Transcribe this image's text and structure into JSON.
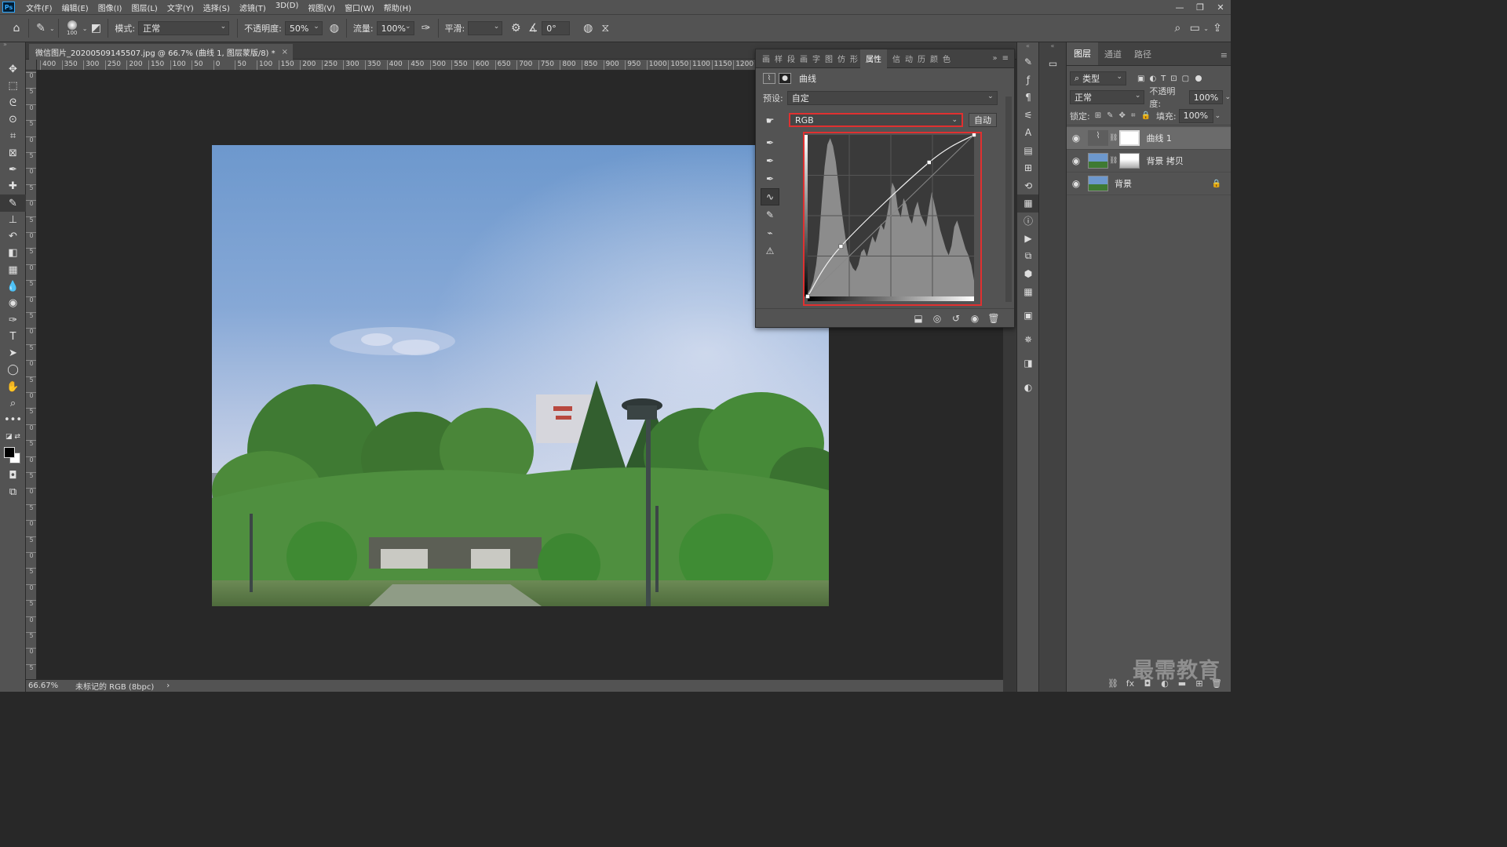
{
  "menubar": {
    "logo": "Ps",
    "items": [
      "文件(F)",
      "编辑(E)",
      "图像(I)",
      "图层(L)",
      "文字(Y)",
      "选择(S)",
      "滤镜(T)",
      "3D(D)",
      "视图(V)",
      "窗口(W)",
      "帮助(H)"
    ],
    "window_controls": [
      "—",
      "❐",
      "✕"
    ]
  },
  "options": {
    "brush_size": "100",
    "mode_label": "模式:",
    "mode_value": "正常",
    "opacity_label": "不透明度:",
    "opacity_value": "50%",
    "flow_label": "流量:",
    "flow_value": "100%",
    "smooth_label": "平滑:",
    "smooth_value": "",
    "angle_value": "0°"
  },
  "document": {
    "tab_title": "微信图片_20200509145507.jpg @ 66.7% (曲线 1, 图层蒙版/8) *",
    "close": "×"
  },
  "ruler": {
    "h_ticks": [
      "400",
      "350",
      "300",
      "250",
      "200",
      "150",
      "100",
      "50",
      "0",
      "50",
      "100",
      "150",
      "200",
      "250",
      "300",
      "350",
      "400",
      "450",
      "500",
      "550",
      "600",
      "650",
      "700",
      "750",
      "800",
      "850",
      "900",
      "950",
      "1000",
      "1050",
      "1100",
      "1150",
      "1200",
      "12"
    ],
    "v_ticks": [
      "0",
      "5",
      "0",
      "5",
      "0",
      "5",
      "0",
      "5",
      "0",
      "5",
      "0",
      "5",
      "0",
      "5",
      "0",
      "5",
      "0",
      "5",
      "0",
      "5",
      "0",
      "5",
      "0",
      "5",
      "0",
      "5",
      "0",
      "5",
      "0",
      "5",
      "0",
      "5",
      "0",
      "5",
      "0",
      "5",
      "0",
      "5"
    ]
  },
  "status": {
    "zoom": "66.67%",
    "profile": "未标记的 RGB (8bpc)",
    "arrow": "›"
  },
  "properties": {
    "tabs": [
      "画",
      "样",
      "段",
      "画",
      "字",
      "图",
      "仿",
      "形"
    ],
    "active_tab": "属性",
    "tabs_right": [
      "信",
      "动",
      "历",
      "颜",
      "色"
    ],
    "collapse": "»",
    "menu": "≡",
    "header": "曲线",
    "preset_label": "预设:",
    "preset_value": "自定",
    "channel": "RGB",
    "auto_button": "自动",
    "curve_points": [
      [
        0,
        0
      ],
      [
        0.2,
        0.31
      ],
      [
        0.73,
        0.83
      ],
      [
        1.0,
        1.0
      ]
    ],
    "histogram": [
      0.02,
      0.05,
      0.1,
      0.2,
      0.36,
      0.6,
      0.82,
      0.96,
      1.0,
      0.95,
      0.85,
      0.7,
      0.55,
      0.42,
      0.3,
      0.22,
      0.18,
      0.16,
      0.2,
      0.28,
      0.3,
      0.25,
      0.32,
      0.38,
      0.34,
      0.4,
      0.46,
      0.42,
      0.5,
      0.6,
      0.72,
      0.68,
      0.55,
      0.5,
      0.62,
      0.58,
      0.5,
      0.46,
      0.55,
      0.6,
      0.52,
      0.48,
      0.44,
      0.56,
      0.66,
      0.58,
      0.5,
      0.42,
      0.36,
      0.3,
      0.26,
      0.32,
      0.44,
      0.48,
      0.42,
      0.36,
      0.3,
      0.26,
      0.2,
      0.1
    ]
  },
  "layers_panel": {
    "tabs": [
      "图层",
      "通道",
      "路径"
    ],
    "filter": "类型",
    "blend": "正常",
    "opacity_label": "不透明度:",
    "opacity_value": "100%",
    "lock_label": "锁定:",
    "fill_label": "填充:",
    "fill_value": "100%",
    "layers": [
      {
        "name": "曲线 1",
        "type": "adjustment",
        "active": true
      },
      {
        "name": "背景 拷贝",
        "type": "masked",
        "active": false
      },
      {
        "name": "背景",
        "type": "background",
        "active": false
      }
    ]
  },
  "watermark": "最需教育",
  "colors": {
    "highlight_red": "#e03030",
    "panel_bg": "#535353",
    "canvas_bg": "#282828"
  }
}
